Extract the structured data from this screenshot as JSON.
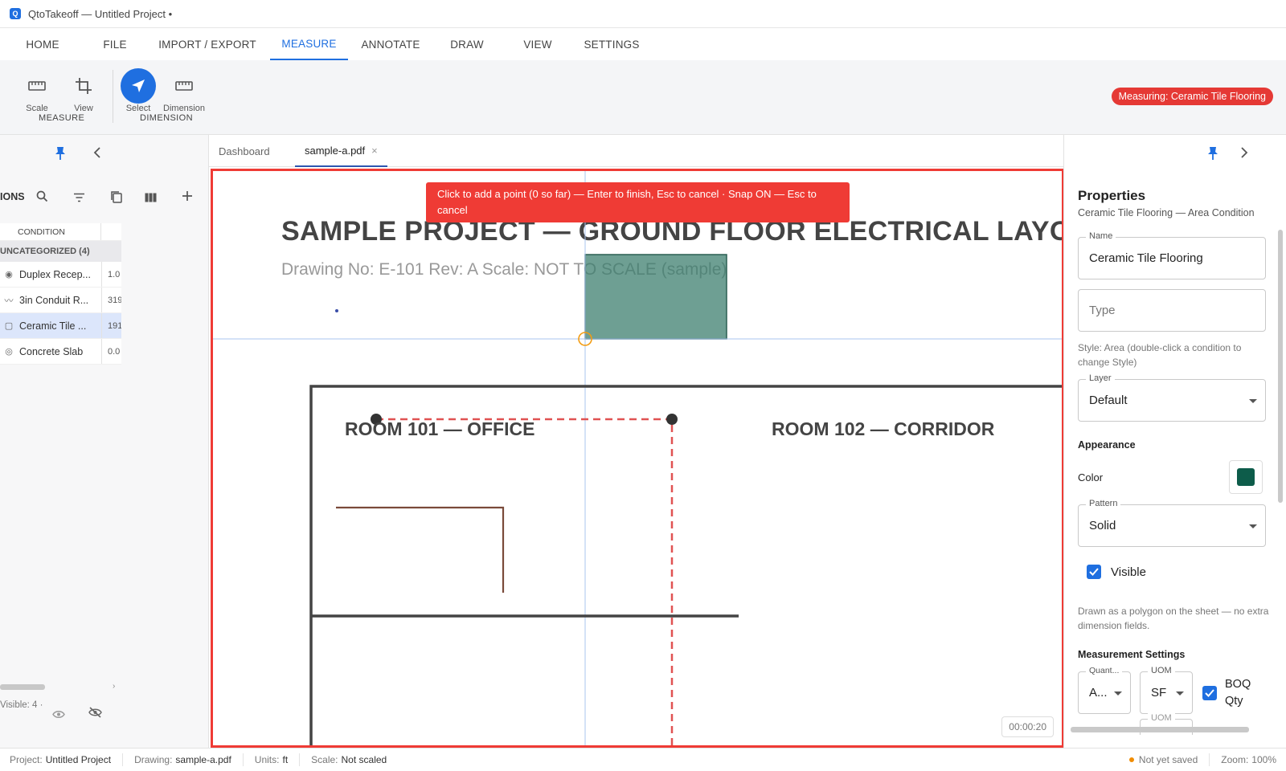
{
  "window": {
    "title": "QtoTakeoff — Untitled Project •",
    "logo_letter": "Q"
  },
  "menu": {
    "tabs": [
      "HOME",
      "FILE",
      "IMPORT / EXPORT",
      "MEASURE",
      "ANNOTATE",
      "DRAW",
      "VIEW",
      "SETTINGS"
    ],
    "active": "MEASURE"
  },
  "ribbon": {
    "tools": {
      "scale": "Scale",
      "view": "View",
      "select": "Select",
      "dimension": "Dimension"
    },
    "groups": {
      "measure": "MEASURE",
      "dimension": "DIMENSION"
    },
    "badge": "Measuring: Ceramic Tile Flooring"
  },
  "left_panel": {
    "section_title": "IONS",
    "column_header": "CONDITION",
    "group": "UNCATEGORIZED (4)",
    "rows": [
      {
        "icon": "duplex-icon",
        "name": "Duplex Recep...",
        "value": "1.0"
      },
      {
        "icon": "linear-icon",
        "name": "3in Conduit R...",
        "value": "319"
      },
      {
        "icon": "area-icon",
        "name": "Ceramic Tile ...",
        "value": "191"
      },
      {
        "icon": "volume-icon",
        "name": "Concrete Slab",
        "value": "0.0"
      }
    ],
    "visible_text": "Visible: 4 ·"
  },
  "doc_tabs": {
    "dashboard": "Dashboard",
    "file": "sample-a.pdf"
  },
  "canvas": {
    "hint": "Click to add a point (0 so far) — Enter to finish, Esc to cancel · Snap ON — Esc to cancel",
    "title": "SAMPLE PROJECT — GROUND FLOOR ELECTRICAL LAYOUT",
    "subtitle": "Drawing No: E-101   Rev: A   Scale: NOT TO SCALE (sample)",
    "room_101": "ROOM 101 — OFFICE",
    "room_102": "ROOM 102 — CORRIDOR",
    "timer": "00:00:20",
    "area_color": "#3d7f6f"
  },
  "properties": {
    "title": "Properties",
    "subtitle": "Ceramic Tile Flooring — Area Condition",
    "name_label": "Name",
    "name_value": "Ceramic Tile Flooring",
    "type_placeholder": "Type",
    "style_note": "Style: Area (double-click a condition to change Style)",
    "layer_label": "Layer",
    "layer_value": "Default",
    "appearance": "Appearance",
    "color_label": "Color",
    "color_value": "#0d5c4a",
    "pattern_label": "Pattern",
    "pattern_value": "Solid",
    "visible_label": "Visible",
    "polygon_note": "Drawn as a polygon on the sheet — no extra dimension fields.",
    "measurement_settings": "Measurement Settings",
    "quantity_label": "Quant...",
    "quantity_value": "A...",
    "uom_label": "UOM",
    "uom_value": "SF",
    "boq_label": "BOQ Qty",
    "uom2_label": "UOM"
  },
  "status": {
    "project_label": "Project:",
    "project": "Untitled Project",
    "drawing_label": "Drawing:",
    "drawing": "sample-a.pdf",
    "units_label": "Units:",
    "units": "ft",
    "scale_label": "Scale:",
    "scale": "Not scaled",
    "save_state": "Not yet saved",
    "zoom_label": "Zoom:",
    "zoom": "100%"
  }
}
